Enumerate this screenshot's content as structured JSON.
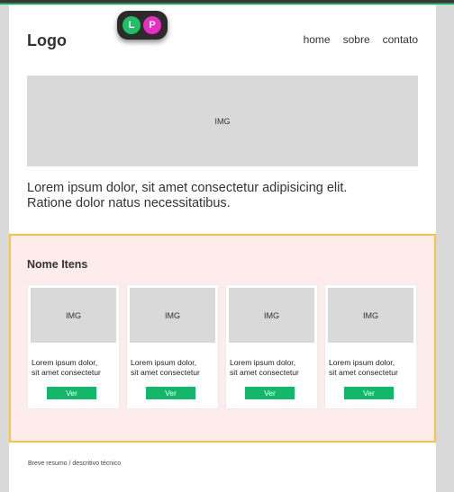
{
  "header": {
    "logo": "Logo",
    "nav": [
      "home",
      "sobre",
      "contato"
    ],
    "badges": {
      "left": "L",
      "right": "P"
    }
  },
  "hero": {
    "label": "IMG"
  },
  "intro": {
    "line1": "Lorem ipsum dolor, sit amet consectetur adipisicing elit.",
    "line2": "Ratione dolor natus necessitatibus."
  },
  "items": {
    "title": "Nome Itens",
    "cards": [
      {
        "img": "IMG",
        "line1": "Lorem ipsum dolor,",
        "line2": "sit amet consectetur",
        "button": "Ver"
      },
      {
        "img": "IMG",
        "line1": "Lorem ipsum dolor,",
        "line2": "sit amet consectetur",
        "button": "Ver"
      },
      {
        "img": "IMG",
        "line1": "Lorem ipsum dolor,",
        "line2": "sit amet consectetur",
        "button": "Ver"
      },
      {
        "img": "IMG",
        "line1": "Lorem ipsum dolor,",
        "line2": "sit amet consectetur",
        "button": "Ver"
      }
    ]
  },
  "footer": {
    "text": "Breve resumo / descritivo técnico"
  },
  "colors": {
    "accent_green": "#12b76a",
    "badge_green": "#1fbf63",
    "badge_pink": "#e82cc4",
    "section_bg": "#fdeceb",
    "section_border": "#f5c542",
    "placeholder_gray": "#d9d9d9"
  }
}
